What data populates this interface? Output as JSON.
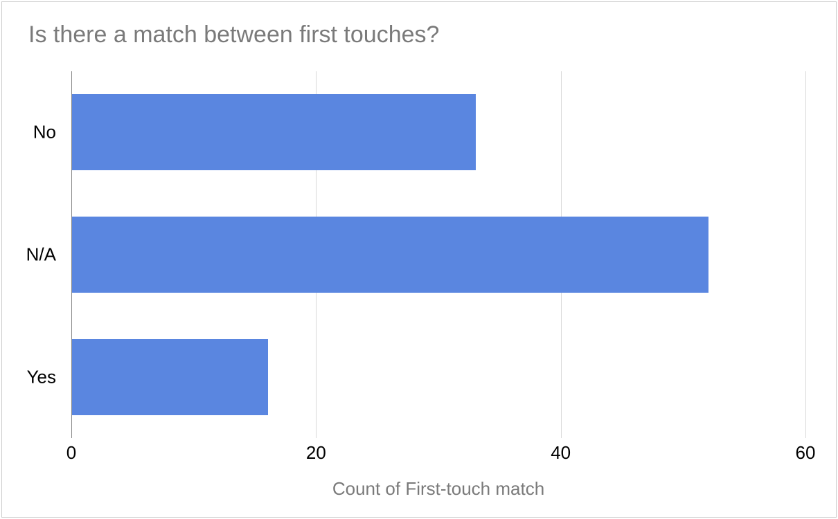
{
  "chart_data": {
    "type": "bar",
    "orientation": "horizontal",
    "title": "Is there a match between first touches?",
    "xlabel": "Count of First-touch match",
    "ylabel": "",
    "categories": [
      "No",
      "N/A",
      "Yes"
    ],
    "values": [
      33,
      52,
      16
    ],
    "xlim": [
      0,
      60
    ],
    "x_ticks": [
      0,
      20,
      40,
      60
    ],
    "bar_color": "#5a86e0",
    "grid": true
  }
}
